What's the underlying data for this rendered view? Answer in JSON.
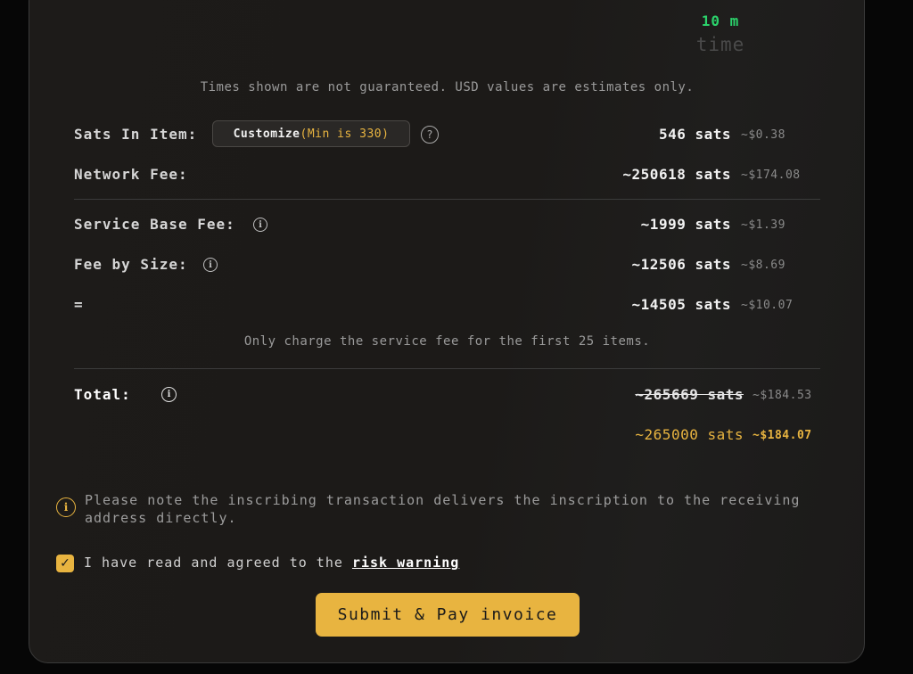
{
  "timing": {
    "value": "10 m",
    "label": "time"
  },
  "disclaimer": "Times shown are not guaranteed. USD values are estimates only.",
  "rows": {
    "sats_in_item": {
      "label": "Sats In Item:",
      "customize_label": "Customize",
      "customize_min": "(Min is 330)",
      "help_icon": "question-circle-icon",
      "sats": "546 sats",
      "usd": "~$0.38"
    },
    "network_fee": {
      "label": "Network Fee:",
      "sats": "~250618 sats",
      "usd": "~$174.08"
    },
    "service_base_fee": {
      "label": "Service Base Fee:",
      "sats": "~1999 sats",
      "usd": "~$1.39",
      "icon": "info-icon"
    },
    "fee_by_size": {
      "label": "Fee by Size:",
      "sats": "~12506 sats",
      "usd": "~$8.69",
      "icon": "info-icon"
    },
    "subtotal": {
      "label": "=",
      "sats": "~14505 sats",
      "usd": "~$10.07"
    }
  },
  "service_note": "Only charge the service fee for the first 25 items.",
  "total": {
    "label": "Total:",
    "original_sats": "~265669 sats",
    "original_usd": "~$184.53",
    "discounted_sats": "~265000 sats",
    "discounted_usd": "~$184.07"
  },
  "notice": "Please note the inscribing transaction delivers the inscription to the receiving address directly.",
  "agreement": {
    "checked": true,
    "text": "I have read and agreed to the ",
    "link": "risk warning"
  },
  "submit_label": "Submit & Pay invoice",
  "colors": {
    "accent": "#e8b440",
    "time_green": "#2bd26b",
    "panel_bg": "#1d1b19"
  }
}
